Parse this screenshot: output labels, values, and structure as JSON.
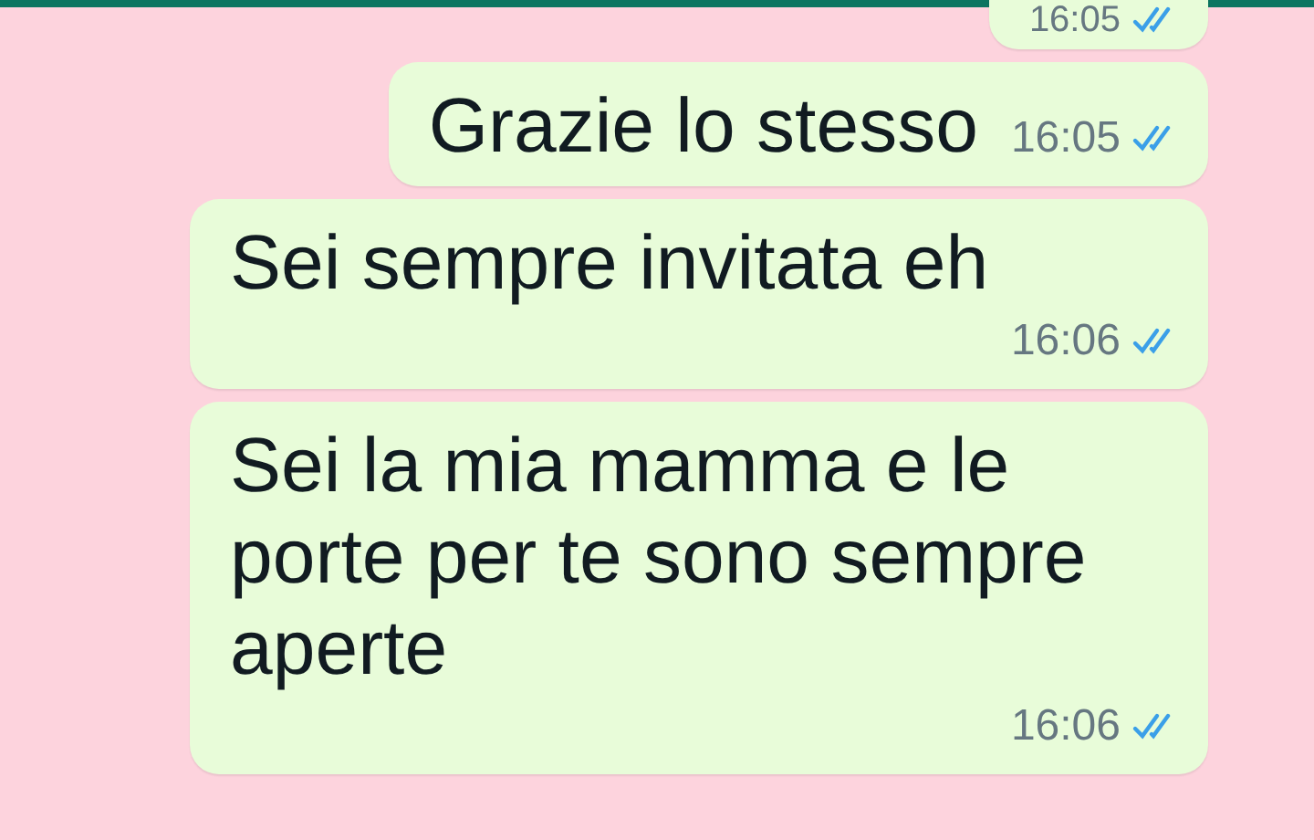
{
  "messages": [
    {
      "time": "16:05",
      "read": true
    },
    {
      "text": "Grazie lo stesso",
      "time": "16:05",
      "read": true
    },
    {
      "text": "Sei sempre invitata eh",
      "time": "16:06",
      "read": true
    },
    {
      "text": "Sei la mia mamma e le porte per te sono sempre aperte",
      "time": "16:06",
      "read": true
    }
  ]
}
